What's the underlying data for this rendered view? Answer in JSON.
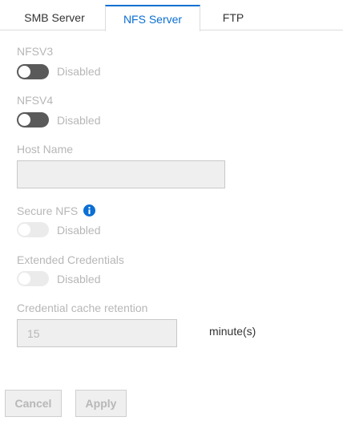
{
  "tabs": [
    {
      "label": "SMB Server"
    },
    {
      "label": "NFS Server"
    },
    {
      "label": "FTP"
    }
  ],
  "nfsv3": {
    "label": "NFSV3",
    "state": "Disabled"
  },
  "nfsv4": {
    "label": "NFSV4",
    "state": "Disabled"
  },
  "host_name": {
    "label": "Host Name",
    "value": ""
  },
  "secure_nfs": {
    "label": "Secure NFS",
    "state": "Disabled",
    "info_icon": "info-icon"
  },
  "extended_credentials": {
    "label": "Extended Credentials",
    "state": "Disabled"
  },
  "credential_cache": {
    "label": "Credential cache retention",
    "value": "15",
    "unit": "minute(s)"
  },
  "buttons": {
    "cancel": "Cancel",
    "apply": "Apply"
  },
  "colors": {
    "accent": "#0b6fd3",
    "toggle_dark": "#5a5a5a",
    "toggle_light": "#ebebeb"
  }
}
